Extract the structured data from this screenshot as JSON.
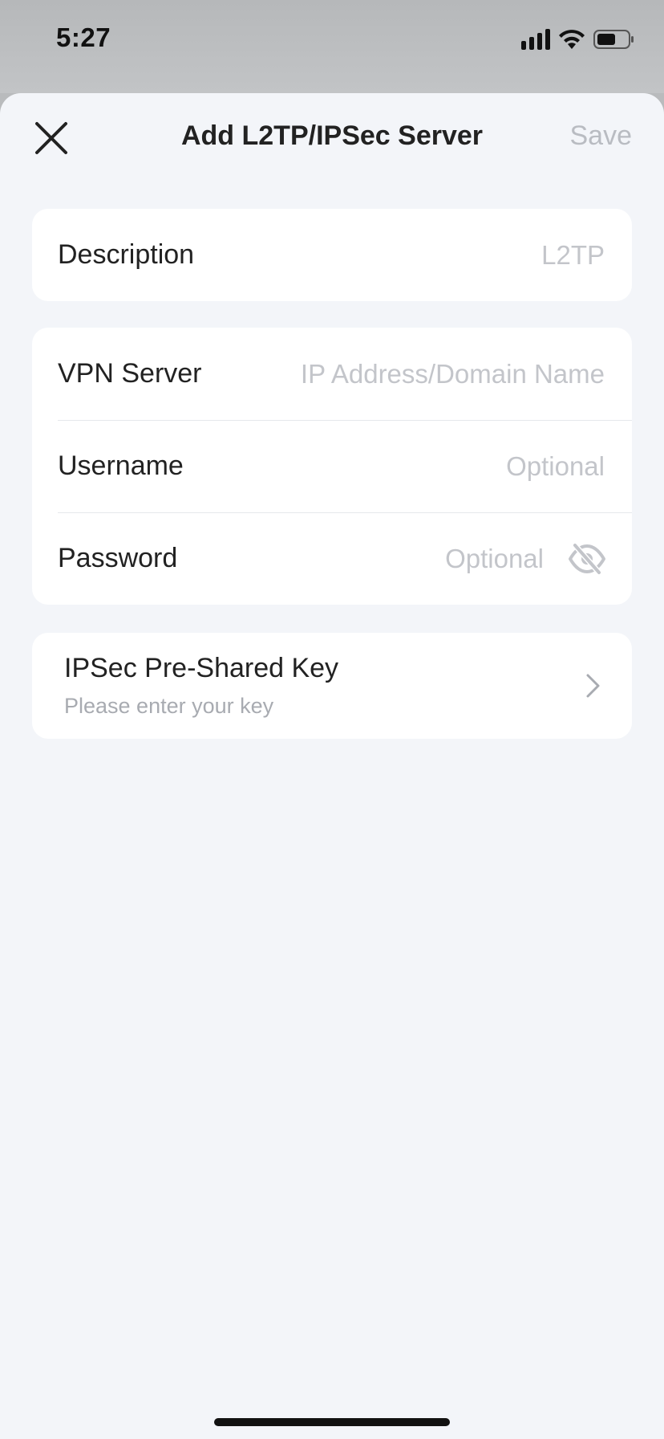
{
  "status_bar": {
    "time": "5:27",
    "icons": [
      "cellular-signal-icon",
      "wifi-icon",
      "battery-icon"
    ]
  },
  "nav": {
    "title": "Add L2TP/IPSec Server",
    "save_label": "Save",
    "close_icon": "close-icon"
  },
  "description_card": {
    "label": "Description",
    "value": "",
    "placeholder": "L2TP"
  },
  "server_card": {
    "vpn_server": {
      "label": "VPN Server",
      "value": "",
      "placeholder": "IP Address/Domain Name"
    },
    "username": {
      "label": "Username",
      "value": "",
      "placeholder": "Optional"
    },
    "password": {
      "label": "Password",
      "value": "",
      "placeholder": "Optional",
      "visibility_icon": "eye-off-icon"
    }
  },
  "psk_card": {
    "title": "IPSec Pre-Shared Key",
    "subtitle": "Please enter your key",
    "icon": "chevron-right-icon"
  },
  "colors": {
    "sheet_background": "#f3f5f9",
    "card_background": "#ffffff",
    "placeholder": "#c3c5ca",
    "save_disabled": "#b9bcc2",
    "backdrop": "#b9bbbd"
  }
}
